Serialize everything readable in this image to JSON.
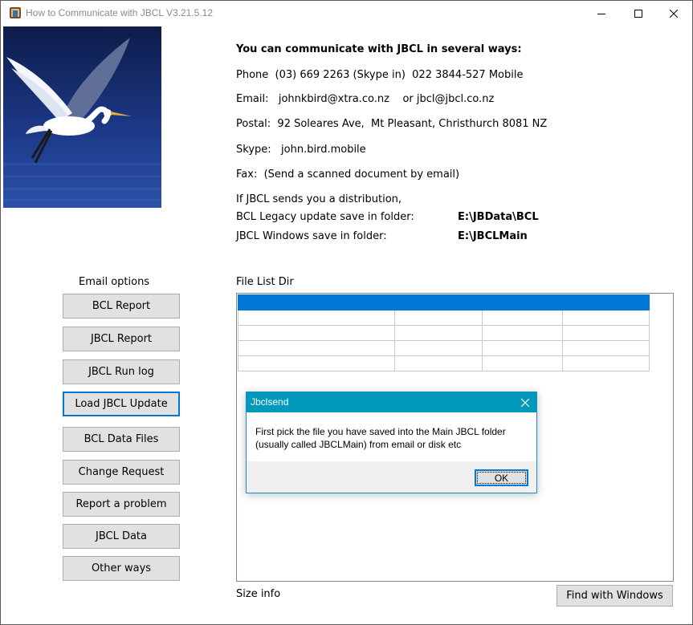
{
  "window": {
    "title": "How to Communicate with JBCL V3.21.5.12"
  },
  "info": {
    "heading": "You can communicate with JBCL in several ways:",
    "phone": "Phone  (03) 669 2263 (Skype in)  022 3844-527 Mobile",
    "email": "Email:   johnkbird@xtra.co.nz    or jbcl@jbcl.co.nz",
    "postal": "Postal:  92 Soleares Ave,  Mt Pleasant, Christhurch 8081 NZ",
    "skype": "Skype:   john.bird.mobile",
    "fax": "Fax:  (Send a scanned document by email)",
    "distribution": "If JBCL sends you a distribution,",
    "legacy_label": "BCL Legacy update save in folder:",
    "legacy_path": "E:\\JBData\\BCL",
    "windows_label": "JBCL Windows save in folder:",
    "windows_path": "E:\\JBCLMain"
  },
  "email_options": {
    "label": "Email options",
    "buttons": [
      "BCL Report",
      "JBCL Report",
      "JBCL Run log",
      "Load JBCL Update",
      "BCL Data Files",
      "Change Request",
      "Report a problem",
      "JBCL Data",
      "Other ways"
    ]
  },
  "file_list": {
    "label": "File List Dir"
  },
  "size_info": "Size info",
  "find_button": "Find with Windows",
  "dialog": {
    "title": "Jbclsend",
    "message_line1": "First pick the file you have saved into the Main JBCL folder",
    "message_line2": "(usually called JBCLMain) from email or disk etc",
    "ok": "OK"
  },
  "colors": {
    "accent": "#0078d7",
    "dialog_title_bg": "#0099bc",
    "button_bg": "#e1e1e1"
  }
}
